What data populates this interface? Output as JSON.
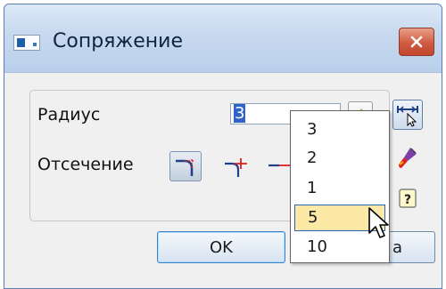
{
  "window": {
    "title": "Сопряжение"
  },
  "form": {
    "radius_label": "Радиус",
    "radius_value": "3",
    "trim_label": "Отсечение"
  },
  "buttons": {
    "ok": "OK",
    "cancel_partial": "a"
  },
  "dropdown": {
    "options": [
      "3",
      "2",
      "1",
      "5",
      "10"
    ],
    "selected": "5"
  },
  "colors": {
    "titlebar": "#c7d9ef",
    "close": "#cf5b40",
    "selection": "#3063c8",
    "highlight": "#fde9a6",
    "accent_red": "#e02020"
  }
}
